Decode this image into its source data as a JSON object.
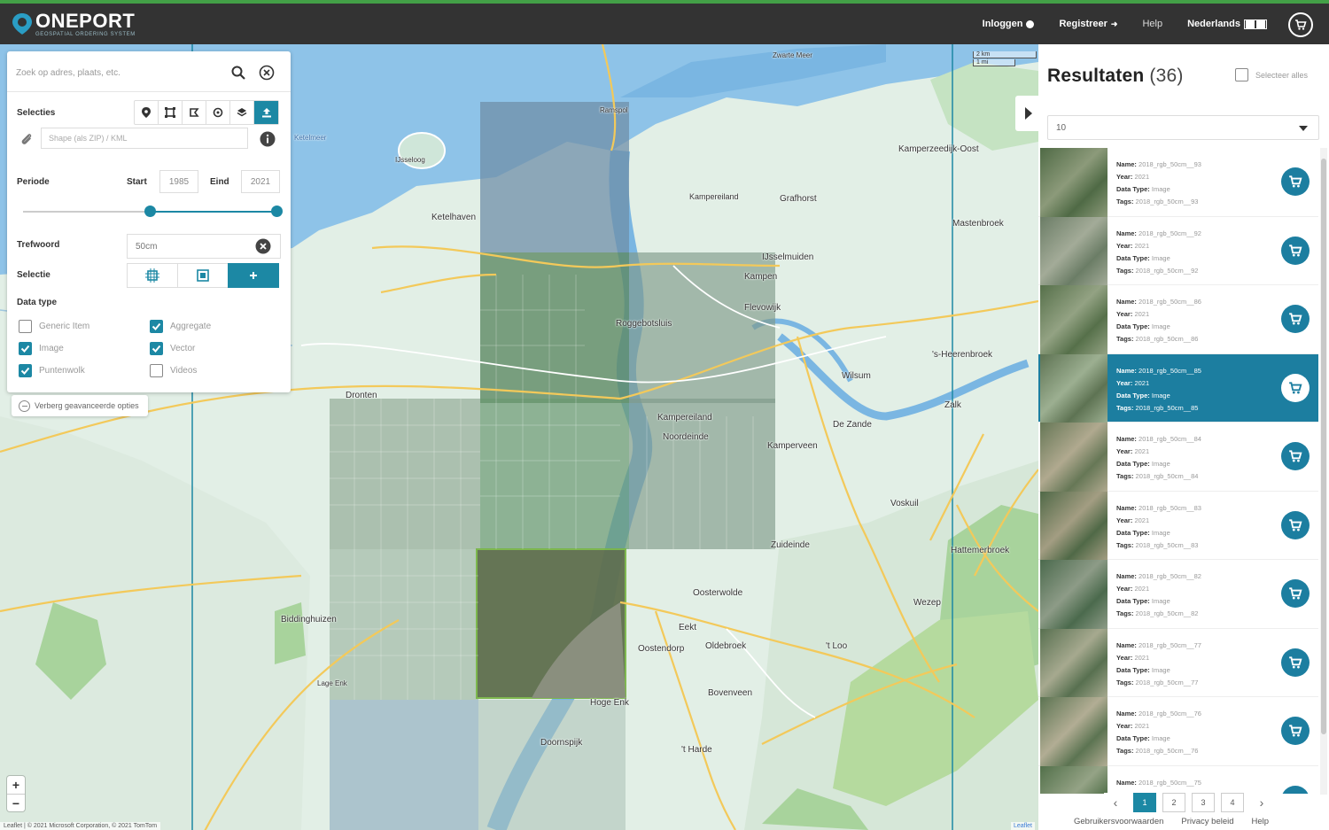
{
  "header": {
    "brand": "ONEPORT",
    "tagline": "GEOSPATIAL ORDERING SYSTEM",
    "nav": {
      "login": "Inloggen",
      "register": "Registreer",
      "help": "Help",
      "language": "Nederlands"
    }
  },
  "search": {
    "placeholder": "Zoek op adres, plaats, etc."
  },
  "filters": {
    "selections_label": "Selecties",
    "shape_placeholder": "Shape (als ZIP) / KML",
    "period_label": "Periode",
    "start_label": "Start",
    "start_value": "1985",
    "end_label": "Eind",
    "end_value": "2021",
    "period_range": {
      "min": 1985,
      "max": 2021,
      "from": 2003,
      "to": 2021
    },
    "keyword_label": "Trefwoord",
    "keyword_value": "50cm",
    "selection_label": "Selectie",
    "datatype_label": "Data type",
    "datatypes": [
      {
        "label": "Generic Item",
        "checked": false
      },
      {
        "label": "Aggregate",
        "checked": true
      },
      {
        "label": "Image",
        "checked": true
      },
      {
        "label": "Vector",
        "checked": true
      },
      {
        "label": "Puntenwolk",
        "checked": true
      },
      {
        "label": "Videos",
        "checked": false
      }
    ],
    "advanced_toggle": "Verberg geavanceerde opties"
  },
  "map": {
    "places": [
      "Zwarte Meer",
      "Ramspol",
      "Ketelmeer",
      "IJsseloog",
      "Kampereiland",
      "Grafhorst",
      "Kamperzeedijk-Oost",
      "Ketelhaven",
      "Mastenbroek",
      "IJsselmuiden",
      "Kampen",
      "Roggebotsluis",
      "Flevowijk",
      "'s-Heerenbroek",
      "Wilsum",
      "Zalk",
      "De Zande",
      "Dronten",
      "Kampereiland",
      "Noordeinde",
      "Kamperveen",
      "Voskuil",
      "Zuideinde",
      "Hattemerbroek",
      "Oosterwolde",
      "Wezep",
      "Biddinghuizen",
      "Eekt",
      "Oldebroek",
      "'t Loo",
      "Oostendorp",
      "Bovenveen",
      "Hoge Enk",
      "Doornspijk",
      "'t Harde",
      "Lage Enk"
    ],
    "scale_labels": [
      "2 km",
      "1 mi"
    ],
    "attribution": "Leaflet | © 2021 Microsoft Corporation, © 2021 TomTom",
    "attribution_right": "Leaflet",
    "zoom_in": "+",
    "zoom_out": "−"
  },
  "results": {
    "title": "Resultaten",
    "count": "(36)",
    "select_all": "Selecteer alles",
    "per_page": "10",
    "field_labels": {
      "name": "Name:",
      "year": "Year:",
      "datatype": "Data Type:",
      "tags": "Tags:"
    },
    "items": [
      {
        "name": "2018_rgb_50cm__93",
        "year": "2021",
        "datatype": "Image",
        "tags": "2018_rgb_50cm__93",
        "selected": false
      },
      {
        "name": "2018_rgb_50cm__92",
        "year": "2021",
        "datatype": "Image",
        "tags": "2018_rgb_50cm__92",
        "selected": false
      },
      {
        "name": "2018_rgb_50cm__86",
        "year": "2021",
        "datatype": "Image",
        "tags": "2018_rgb_50cm__86",
        "selected": false
      },
      {
        "name": "2018_rgb_50cm__85",
        "year": "2021",
        "datatype": "Image",
        "tags": "2018_rgb_50cm__85",
        "selected": true
      },
      {
        "name": "2018_rgb_50cm__84",
        "year": "2021",
        "datatype": "Image",
        "tags": "2018_rgb_50cm__84",
        "selected": false
      },
      {
        "name": "2018_rgb_50cm__83",
        "year": "2021",
        "datatype": "Image",
        "tags": "2018_rgb_50cm__83",
        "selected": false
      },
      {
        "name": "2018_rgb_50cm__82",
        "year": "2021",
        "datatype": "Image",
        "tags": "2018_rgb_50cm__82",
        "selected": false
      },
      {
        "name": "2018_rgb_50cm__77",
        "year": "2021",
        "datatype": "Image",
        "tags": "2018_rgb_50cm__77",
        "selected": false
      },
      {
        "name": "2018_rgb_50cm__76",
        "year": "2021",
        "datatype": "Image",
        "tags": "2018_rgb_50cm__76",
        "selected": false
      },
      {
        "name": "2018_rgb_50cm__75",
        "year": "",
        "datatype": "",
        "tags": "",
        "selected": false
      }
    ],
    "pages": [
      "1",
      "2",
      "3",
      "4"
    ],
    "current_page": "1"
  },
  "footer": {
    "terms": "Gebruikersvoorwaarden",
    "privacy": "Privacy beleid",
    "help": "Help"
  },
  "colors": {
    "accent": "#1c88a4",
    "topbar": "#333333",
    "brand_green": "#43a047"
  }
}
